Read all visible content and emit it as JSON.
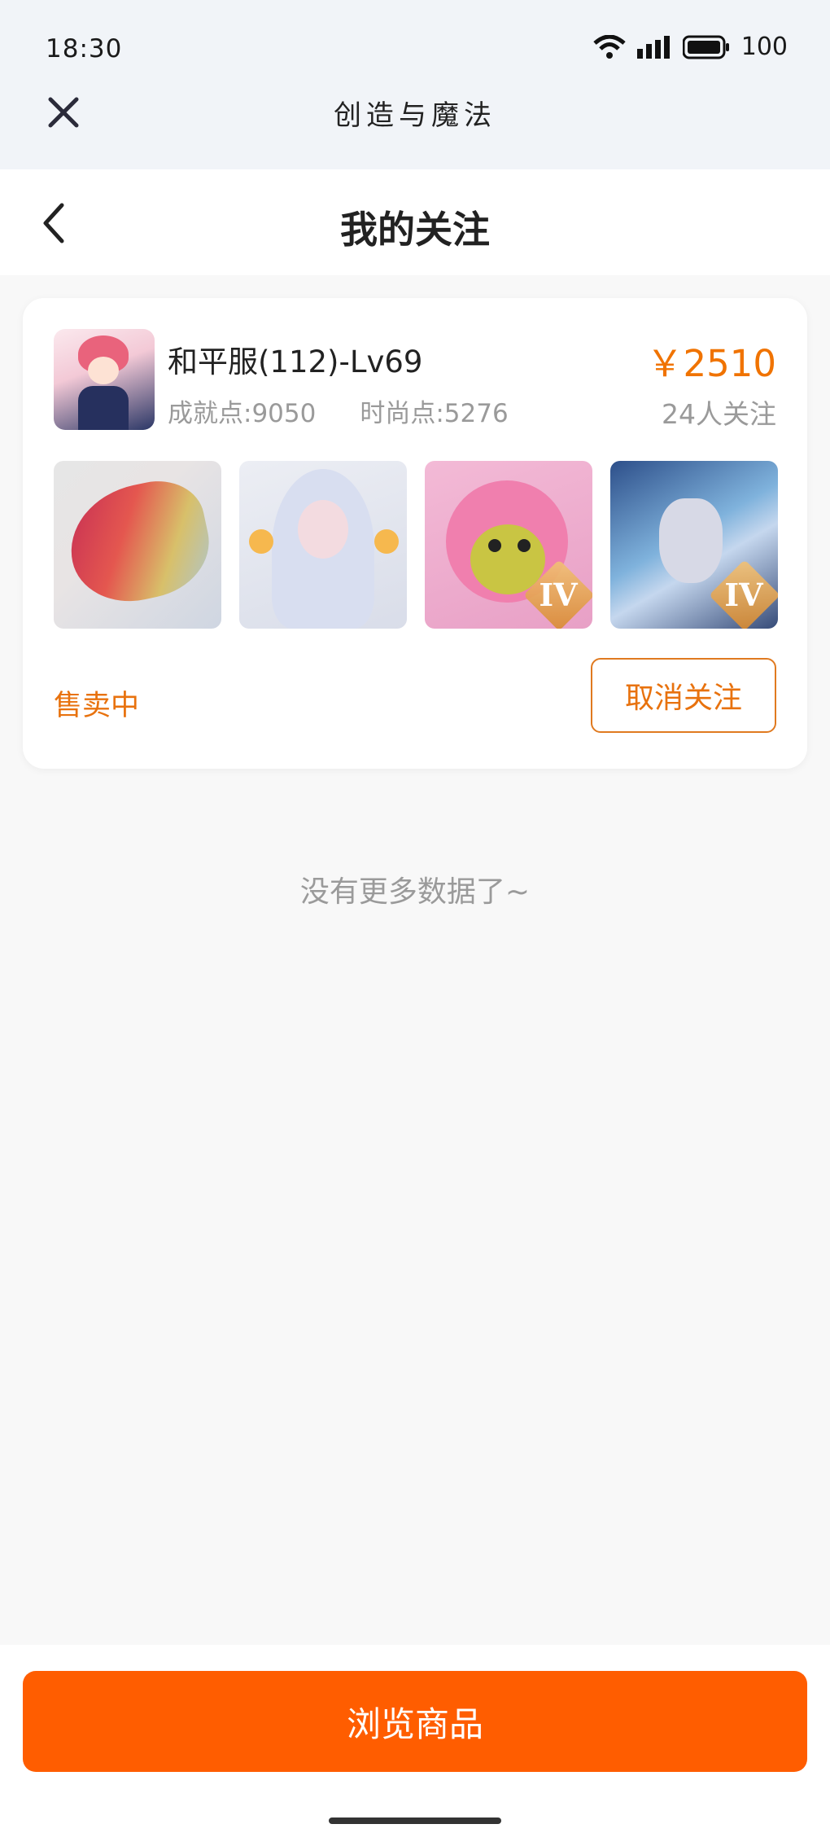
{
  "status_bar": {
    "time": "18:30",
    "battery": "100"
  },
  "app": {
    "title": "创造与魔法"
  },
  "header": {
    "title": "我的关注"
  },
  "card": {
    "title": "和平服(112)-Lv69",
    "achievement": "成就点:9050",
    "fashion": "时尚点:5276",
    "price": "￥2510",
    "followers": "24人关注",
    "thumbnails": [
      {
        "name": "dragon-mount",
        "badge": ""
      },
      {
        "name": "silver-hair-character",
        "badge": ""
      },
      {
        "name": "pink-bear",
        "badge": "IV"
      },
      {
        "name": "armored-knight",
        "badge": "IV"
      }
    ],
    "status": "售卖中",
    "unfollow_label": "取消关注"
  },
  "list": {
    "end_text": "没有更多数据了~"
  },
  "footer": {
    "browse_label": "浏览商品"
  },
  "colors": {
    "accent": "#ff5d00",
    "price": "#f07300"
  }
}
